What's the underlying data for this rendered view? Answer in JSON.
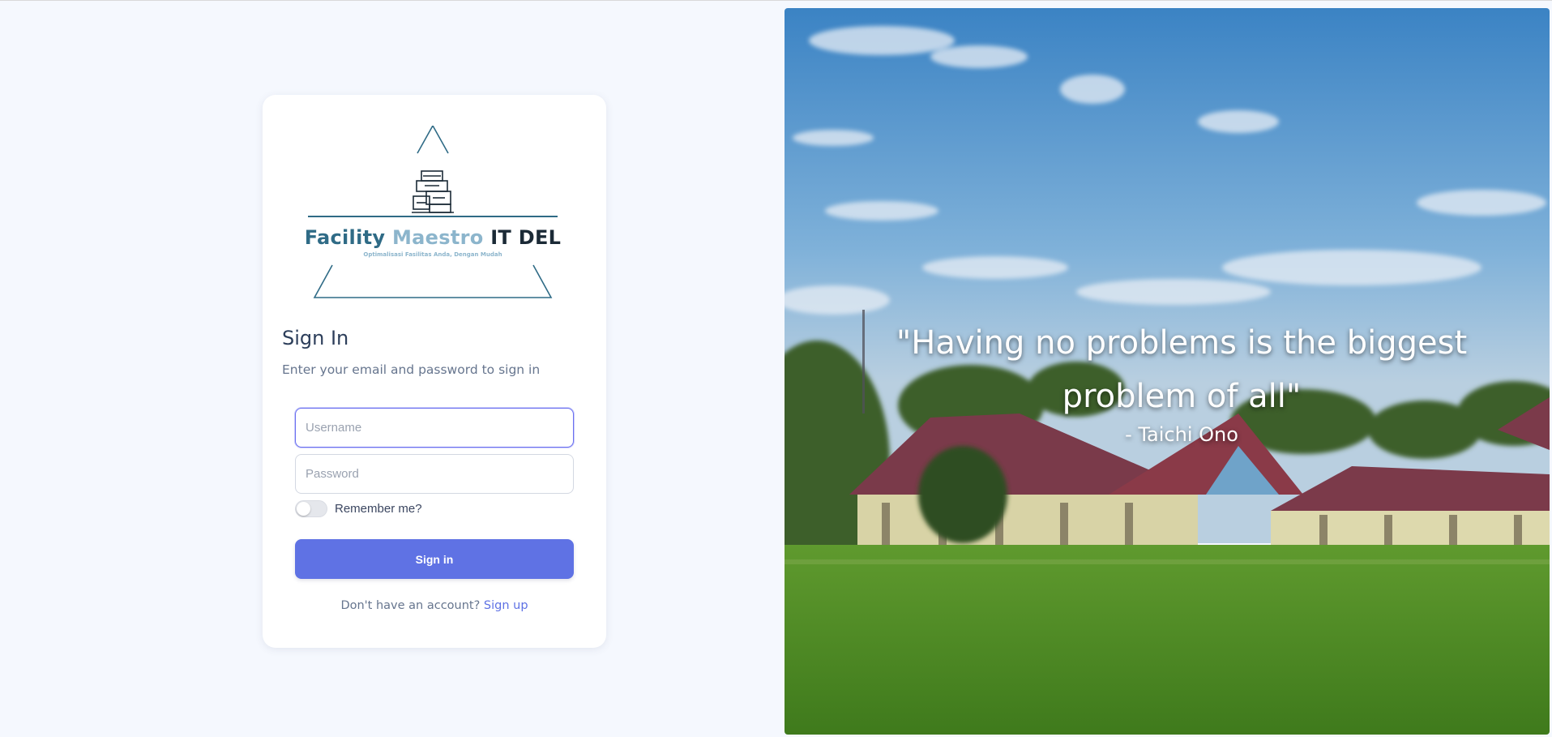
{
  "logo": {
    "title_part1": "Facility",
    "title_part2": "Maestro",
    "title_part3": "IT DEL",
    "tagline": "Optimalisasi Fasilitas Anda, Dengan Mudah"
  },
  "signin": {
    "title": "Sign In",
    "subtitle": "Enter your email and password to sign in",
    "username_placeholder": "Username",
    "username_value": "",
    "password_placeholder": "Password",
    "password_value": "",
    "remember_label": "Remember me?",
    "remember_checked": false,
    "button_label": "Sign in",
    "footer_text": "Don't have an account?",
    "signup_link": "Sign up"
  },
  "hero": {
    "quote": "\"Having no problems is the biggest problem of all\"",
    "author": "- Taichi Ono"
  },
  "colors": {
    "page_background": "#f5f8fe",
    "primary": "#5f72e4",
    "focus_border": "#6a6ff0",
    "heading": "#2c3e5a",
    "muted_text": "#66758e",
    "logo_dark_blue": "#2f6b86",
    "logo_light_blue": "#8cb5cc"
  },
  "icons": {
    "logo_emblem": "stacked-boxes-icon"
  }
}
